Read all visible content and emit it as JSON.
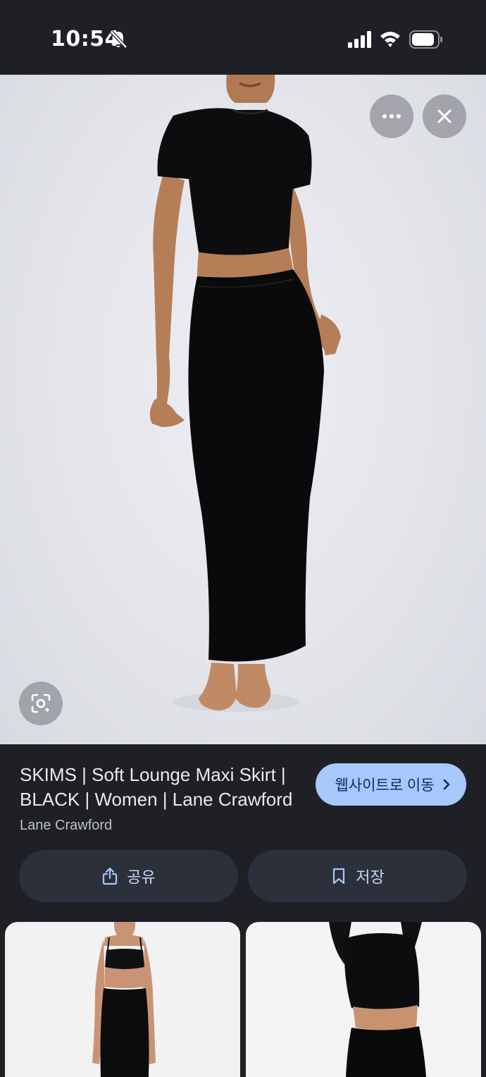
{
  "status_bar": {
    "time": "10:54",
    "icons": [
      "bell-off-icon",
      "signal-icon",
      "wifi-icon",
      "battery-icon"
    ]
  },
  "viewer": {
    "more_icon": "more-horizontal-icon",
    "close_icon": "close-icon",
    "lens_icon": "lens-search-icon"
  },
  "result": {
    "title": "SKIMS | Soft Lounge Maxi Skirt | BLACK | Women | Lane Crawford",
    "source": "Lane Crawford",
    "visit_label": "웹사이트로 이동",
    "share_label": "공유",
    "save_label": "저장"
  },
  "colors": {
    "background": "#1f2026",
    "visit_button": "#a8c7fa",
    "action_button": "#2b303b"
  }
}
